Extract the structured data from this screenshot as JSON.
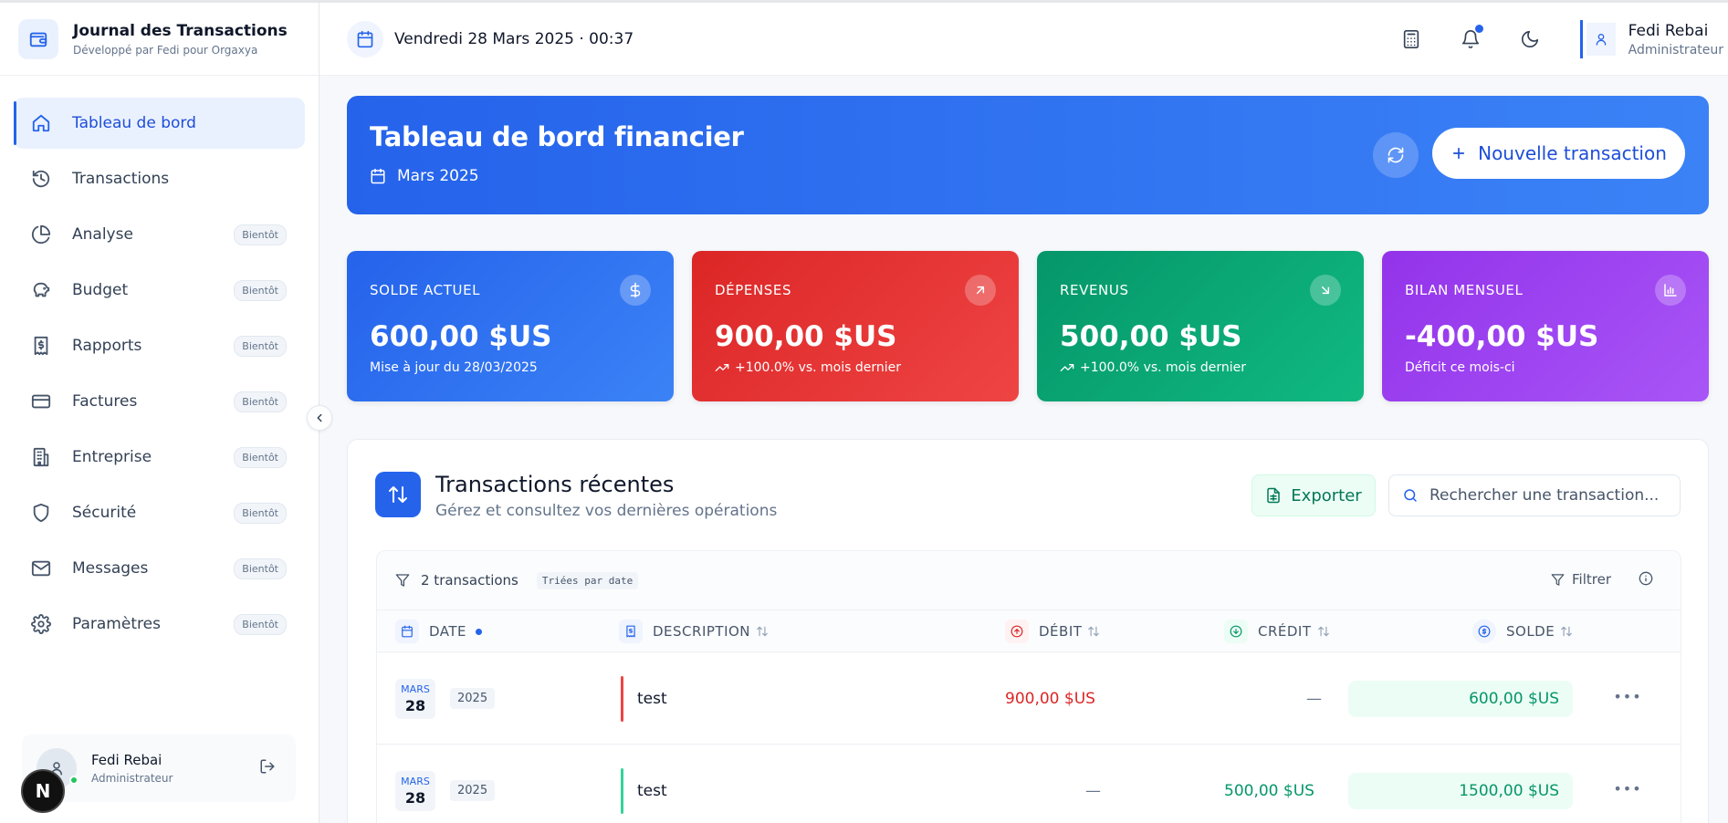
{
  "app": {
    "title": "Journal des Transactions",
    "subtitle": "Développé par Fedi pour Orgaxya"
  },
  "sidebar": {
    "items": [
      {
        "label": "Tableau de bord",
        "icon": "home-icon",
        "active": true,
        "badge": ""
      },
      {
        "label": "Transactions",
        "icon": "history-icon",
        "active": false,
        "badge": ""
      },
      {
        "label": "Analyse",
        "icon": "pie-chart-icon",
        "active": false,
        "badge": "Bientôt"
      },
      {
        "label": "Budget",
        "icon": "piggy-bank-icon",
        "active": false,
        "badge": "Bientôt"
      },
      {
        "label": "Rapports",
        "icon": "receipt-icon",
        "active": false,
        "badge": "Bientôt"
      },
      {
        "label": "Factures",
        "icon": "credit-card-icon",
        "active": false,
        "badge": "Bientôt"
      },
      {
        "label": "Entreprise",
        "icon": "building-icon",
        "active": false,
        "badge": "Bientôt"
      },
      {
        "label": "Sécurité",
        "icon": "shield-icon",
        "active": false,
        "badge": "Bientôt"
      },
      {
        "label": "Messages",
        "icon": "mail-icon",
        "active": false,
        "badge": "Bientôt"
      },
      {
        "label": "Paramètres",
        "icon": "gear-icon",
        "active": false,
        "badge": "Bientôt"
      }
    ],
    "user": {
      "name": "Fedi Rebai",
      "role": "Administrateur"
    },
    "dev_badge": "N"
  },
  "header": {
    "datetime": "Vendredi 28 Mars 2025 · 00:37",
    "user": {
      "name": "Fedi Rebai",
      "role": "Administrateur"
    }
  },
  "hero": {
    "title": "Tableau de bord financier",
    "period": "Mars 2025",
    "new_button": "Nouvelle transaction"
  },
  "stats": [
    {
      "label": "SOLDE ACTUEL",
      "value": "600,00 $US",
      "note": "Mise à jour du 28/03/2025",
      "icon": "dollar-icon",
      "trend": false,
      "color": "#2f6ff0"
    },
    {
      "label": "DÉPENSES",
      "value": "900,00 $US",
      "note": "+100.0% vs. mois dernier",
      "icon": "arrow-up-right-icon",
      "trend": true,
      "color": "#e2332f"
    },
    {
      "label": "REVENUS",
      "value": "500,00 $US",
      "note": "+100.0% vs. mois dernier",
      "icon": "arrow-down-right-icon",
      "trend": true,
      "color": "#10a46b"
    },
    {
      "label": "BILAN MENSUEL",
      "value": "-400,00 $US",
      "note": "Déficit ce mois-ci",
      "icon": "bar-chart-icon",
      "trend": false,
      "color": "#9a37ef"
    }
  ],
  "transactions": {
    "title": "Transactions récentes",
    "subtitle": "Gérez et consultez vos dernières opérations",
    "export_label": "Exporter",
    "search_placeholder": "Rechercher une transaction...",
    "count_label": "2 transactions",
    "sort_label": "Triées par date",
    "filter_label": "Filtrer",
    "columns": {
      "date": "DATE",
      "description": "DESCRIPTION",
      "debit": "DÉBIT",
      "credit": "CRÉDIT",
      "balance": "SOLDE"
    },
    "rows": [
      {
        "month": "MARS",
        "day": "28",
        "year": "2025",
        "description": "test",
        "debit": "900,00 $US",
        "credit": "—",
        "balance": "600,00 $US",
        "type": "debit"
      },
      {
        "month": "MARS",
        "day": "28",
        "year": "2025",
        "description": "test",
        "debit": "—",
        "credit": "500,00 $US",
        "balance": "1500,00 $US",
        "type": "credit"
      }
    ]
  }
}
